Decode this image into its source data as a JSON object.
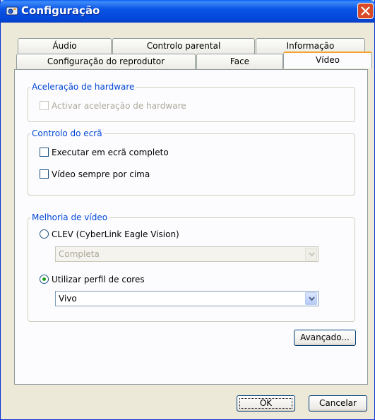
{
  "window": {
    "title": "Configuração"
  },
  "tabs_back": [
    "Áudio",
    "Controlo parental",
    "Informação"
  ],
  "tabs_front": [
    "Configuração do reprodutor",
    "Face",
    "Vídeo"
  ],
  "groups": {
    "hardware": {
      "legend": "Aceleração de hardware",
      "checkbox_label": "Activar aceleração de hardware",
      "checked": false,
      "enabled": false
    },
    "screen": {
      "legend": "Controlo do ecrã",
      "fullscreen_label": "Executar em ecrã completo",
      "fullscreen_checked": false,
      "ontop_label": "Vídeo sempre por cima",
      "ontop_checked": false
    },
    "enhancement": {
      "legend": "Melhoria de vídeo",
      "clev_label": "CLEV (CyberLink Eagle Vision)",
      "clev_selected": false,
      "clev_value": "Completa",
      "profile_label": "Utilizar perfil de cores",
      "profile_selected": true,
      "profile_value": "Vivo"
    }
  },
  "buttons": {
    "advanced": "Avançado...",
    "ok": "OK",
    "cancel": "Cancelar"
  },
  "colors": {
    "title_bar": "#0b55e6",
    "close_button": "#d84a28",
    "group_legend": "#0046d5",
    "active_tab_accent": "#f6a22a"
  }
}
